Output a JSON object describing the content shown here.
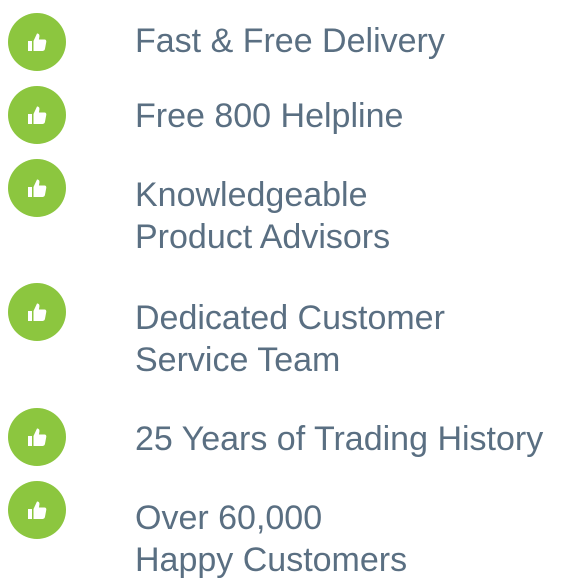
{
  "theme": {
    "badge_color": "#8cc63f",
    "icon_color": "#ffffff",
    "text_color": "#5a6f82"
  },
  "features": [
    {
      "icon": "thumbs-up-icon",
      "lines": [
        "Fast & Free Delivery"
      ]
    },
    {
      "icon": "thumbs-up-icon",
      "lines": [
        "Free 800 Helpline"
      ]
    },
    {
      "icon": "thumbs-up-icon",
      "lines": [
        "Knowledgeable",
        "Product Advisors"
      ]
    },
    {
      "icon": "thumbs-up-icon",
      "lines": [
        "Dedicated Customer",
        "Service Team"
      ]
    },
    {
      "icon": "thumbs-up-icon",
      "lines": [
        "25 Years of Trading History"
      ]
    },
    {
      "icon": "thumbs-up-icon",
      "lines": [
        "Over 60,000",
        "Happy Customers"
      ]
    }
  ]
}
